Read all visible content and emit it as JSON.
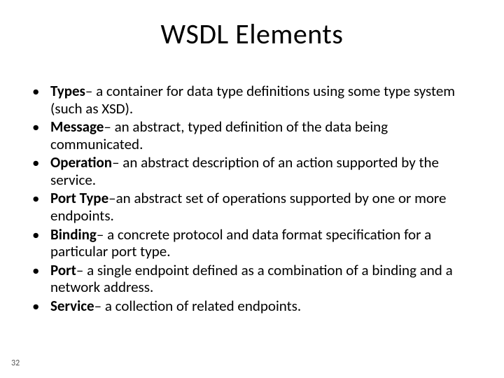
{
  "title": "WSDL Elements",
  "bullets": [
    {
      "term": "Types",
      "desc": "– a container for data type definitions using some type system (such as XSD)."
    },
    {
      "term": "Message",
      "desc": "– an abstract, typed definition of the data being communicated."
    },
    {
      "term": "Operation",
      "desc": "– an abstract description of an action supported by the service."
    },
    {
      "term": "Port Type",
      "desc": "–an abstract set of operations supported by one or more endpoints."
    },
    {
      "term": "Binding",
      "desc": "– a concrete protocol and data format specification for a particular port type."
    },
    {
      "term": "Port",
      "desc": "– a single endpoint defined as a combination of a binding and a network address."
    },
    {
      "term": "Service",
      "desc": "– a collection of related endpoints."
    }
  ],
  "page_number": "32"
}
